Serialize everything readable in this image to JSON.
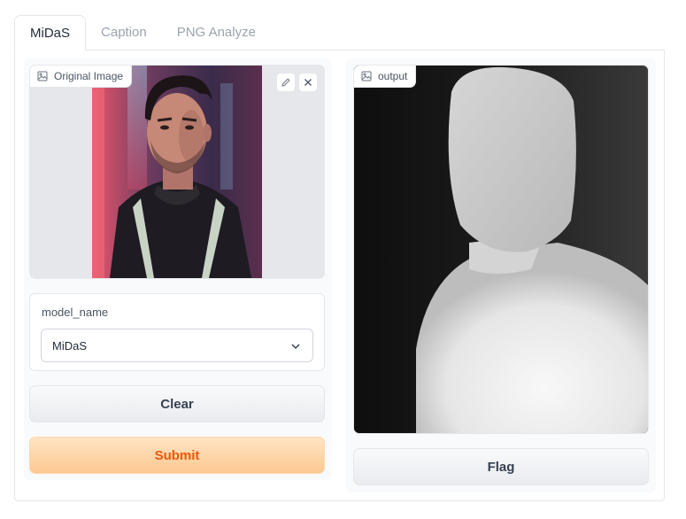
{
  "tabs": [
    {
      "label": "MiDaS",
      "active": true
    },
    {
      "label": "Caption",
      "active": false
    },
    {
      "label": "PNG Analyze",
      "active": false
    }
  ],
  "input_image": {
    "label": "Original Image",
    "icon": "image-icon",
    "actions": [
      "pencil-icon",
      "close-icon"
    ]
  },
  "model": {
    "label": "model_name",
    "selected": "MiDaS",
    "icon": "chevron-down-icon"
  },
  "buttons": {
    "clear": "Clear",
    "submit": "Submit",
    "flag": "Flag"
  },
  "output_image": {
    "label": "output",
    "icon": "image-icon"
  },
  "colors": {
    "submit_text": "#ea580c",
    "submit_bg": "#fdc991",
    "panel_bg": "#f9fafb"
  }
}
